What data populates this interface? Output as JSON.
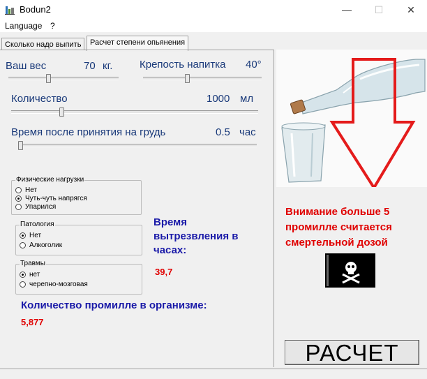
{
  "window": {
    "title": "Bodun2",
    "minimize": "—",
    "maximize": "☐",
    "close": "✕"
  },
  "menu": {
    "items": [
      "Language",
      "?"
    ]
  },
  "tabs": [
    {
      "label": "Сколько надо выпить",
      "active": false
    },
    {
      "label": "Расчет степени опьянения",
      "active": true
    }
  ],
  "sliders": {
    "weight": {
      "label": "Ваш вес",
      "value": "70",
      "unit": "кг.",
      "level": 0.35
    },
    "strength": {
      "label": "Крепость напитка",
      "value": "40°",
      "level": 0.4
    },
    "amount": {
      "label": "Количество",
      "value": "1000",
      "unit": "мл",
      "level": 0.2
    },
    "time": {
      "label": "Время после принятия на грудь",
      "value": "0.5",
      "unit": "час",
      "level": 0.0
    }
  },
  "groups": {
    "physical": {
      "title": "Физические нагрузки",
      "options": [
        "Нет",
        "Чуть-чуть напрягся",
        "Упарился"
      ],
      "selected": 1
    },
    "pathology": {
      "title": "Патология",
      "options": [
        "Нет",
        "Алкоголик"
      ],
      "selected": 0
    },
    "injury": {
      "title": "Травмы",
      "options": [
        "нет",
        "черепно-мозговая"
      ],
      "selected": 0
    }
  },
  "results": {
    "sober_time_line1": "Время",
    "sober_time_line2": "вытрезвления в",
    "sober_time_line3": "часах:",
    "sober_time_value": "39,7",
    "promille_label": "Количество промилле в организме:",
    "promille_value": "5,877"
  },
  "warning": {
    "line1": "Внимание больше 5",
    "line2": "промилле считается",
    "line3": "смертельной дозой"
  },
  "calc_button": "РАСЧЕТ",
  "colors": {
    "label_blue": "#1a3a7a",
    "heading_blue": "#1a1aa8",
    "warning_red": "#e00000",
    "arrow_red": "#e41b1b"
  },
  "icons": [
    "app-icon",
    "bottle-glass-image",
    "down-arrow-icon",
    "pirate-flag-icon"
  ]
}
